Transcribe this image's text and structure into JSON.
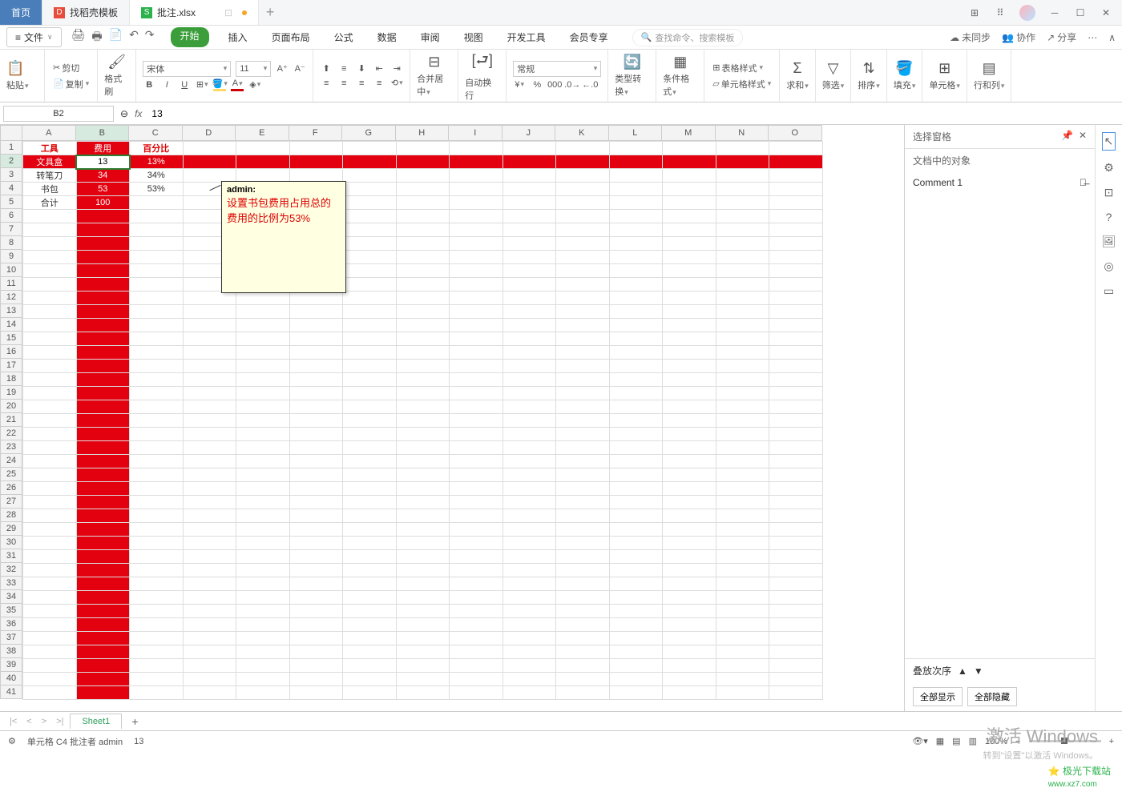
{
  "titlebar": {
    "home_tab": "首页",
    "template_tab": "找稻壳模板",
    "doc_tab": "批注.xlsx"
  },
  "menu": {
    "file_label": "文件",
    "tabs": [
      "开始",
      "插入",
      "页面布局",
      "公式",
      "数据",
      "审阅",
      "视图",
      "开发工具",
      "会员专享"
    ],
    "active_index": 0,
    "search_placeholder": "查找命令、搜索模板",
    "unsync": "未同步",
    "coop": "协作",
    "share": "分享"
  },
  "ribbon": {
    "paste": "粘贴",
    "cut": "剪切",
    "copy": "复制",
    "format_painter": "格式刷",
    "font_name": "宋体",
    "font_size": "11",
    "merge_center": "合并居中",
    "auto_wrap": "自动换行",
    "number_format": "常规",
    "type_convert": "类型转换",
    "cond_format": "条件格式",
    "table_style": "表格样式",
    "cell_style": "单元格样式",
    "sum": "求和",
    "filter": "筛选",
    "sort": "排序",
    "fill": "填充",
    "cells": "单元格",
    "rowcol": "行和列"
  },
  "formula": {
    "cell_ref": "B2",
    "value": "13"
  },
  "columns": [
    "A",
    "B",
    "C",
    "D",
    "E",
    "F",
    "G",
    "H",
    "I",
    "J",
    "K",
    "L",
    "M",
    "N",
    "O"
  ],
  "row_count": 41,
  "active_cell": {
    "row": 2,
    "col": "B"
  },
  "sheet_data": {
    "headers": [
      "工具",
      "费用",
      "百分比"
    ],
    "rows": [
      {
        "a": "文具盒",
        "b": "13",
        "c": "13%"
      },
      {
        "a": "转笔刀",
        "b": "34",
        "c": "34%"
      },
      {
        "a": "书包",
        "b": "53",
        "c": "53%"
      },
      {
        "a": "合计",
        "b": "100",
        "c": ""
      }
    ]
  },
  "comment": {
    "author": "admin:",
    "text": "设置书包费用占用总的费用的比例为53%"
  },
  "right_panel": {
    "title": "选择窗格",
    "subtitle": "文档中的对象",
    "item": "Comment 1",
    "stack_label": "叠放次序",
    "show_all": "全部显示",
    "hide_all": "全部隐藏"
  },
  "sheet_tab": "Sheet1",
  "status": {
    "cell_info": "单元格 C4 批注者 admin",
    "value": "13",
    "zoom": "100%"
  },
  "watermark": {
    "l1": "激活 Windows",
    "l2": "转到\"设置\"以激活 Windows。"
  },
  "logo": "极光下载站"
}
